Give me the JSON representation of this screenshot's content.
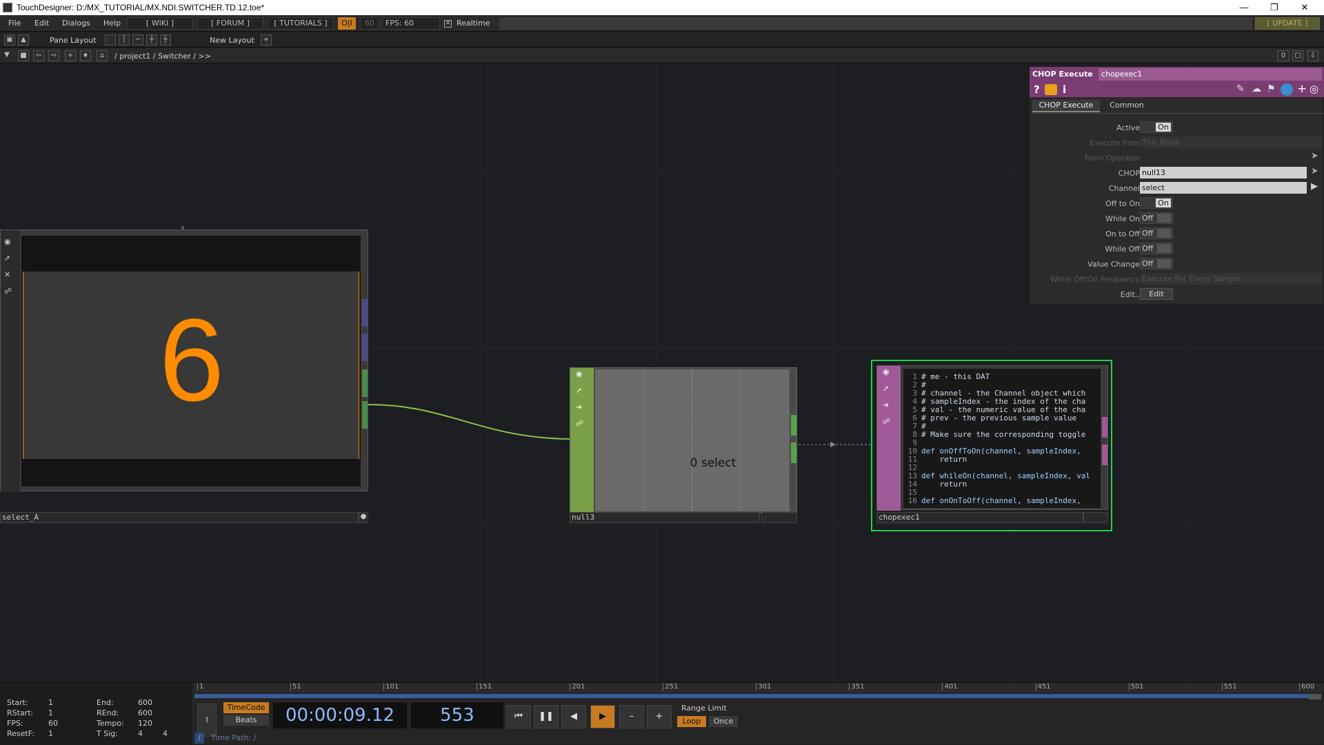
{
  "window": {
    "title": "TouchDesigner: D:/MX_TUTORIAL/MX.NDI.SWITCHER.TD.12.toe*"
  },
  "menu": {
    "items": [
      "File",
      "Edit",
      "Dialogs",
      "Help"
    ],
    "wiki": "[ WIKI ]",
    "forum": "[ FORUM ]",
    "tutorials": "[ TUTORIALS ]",
    "oi": "O|I",
    "fps_cap": "60",
    "fps": "FPS: 60",
    "realtime": "Realtime",
    "update": "[ UPDATE ]"
  },
  "layout": {
    "pane_layout": "Pane Layout",
    "new_layout": "New Layout"
  },
  "path": {
    "crumbs": "/ project1 / Switcher / >>",
    "right_num": "0"
  },
  "nodes": {
    "select_a": {
      "name": "select_A",
      "value": "6",
      "accent": "#ff8c00"
    },
    "null3": {
      "name": "null3",
      "channel_value": "0",
      "channel_name": "select"
    },
    "chopexec": {
      "name": "chopexec1",
      "lines": [
        {
          "n": "1",
          "t": "# me - this DAT"
        },
        {
          "n": "2",
          "t": "#"
        },
        {
          "n": "3",
          "t": "# channel - the Channel object which"
        },
        {
          "n": "4",
          "t": "# sampleIndex - the index of the cha"
        },
        {
          "n": "5",
          "t": "# val - the numeric value of the cha"
        },
        {
          "n": "6",
          "t": "# prev - the previous sample value"
        },
        {
          "n": "7",
          "t": "#"
        },
        {
          "n": "8",
          "t": "# Make sure the corresponding toggle"
        },
        {
          "n": "9",
          "t": ""
        },
        {
          "n": "10",
          "t": "def onOffToOn(channel, sampleIndex,"
        },
        {
          "n": "11",
          "t": "    return"
        },
        {
          "n": "12",
          "t": ""
        },
        {
          "n": "13",
          "t": "def whileOn(channel, sampleIndex, val"
        },
        {
          "n": "14",
          "t": "    return"
        },
        {
          "n": "15",
          "t": ""
        },
        {
          "n": "16",
          "t": "def onOnToOff(channel, sampleIndex,"
        }
      ]
    }
  },
  "params": {
    "type": "CHOP Execute",
    "name": "chopexec1",
    "tabs": [
      "CHOP Execute",
      "Common"
    ],
    "active": {
      "label": "Active",
      "value": "On"
    },
    "execute_from": {
      "label": "Execute from",
      "value": "This Node"
    },
    "from_operator": {
      "label": "From Operator"
    },
    "chop": {
      "label": "CHOP",
      "value": "null13"
    },
    "channel": {
      "label": "Channel",
      "value": "select"
    },
    "off_to_on": {
      "label": "Off to On",
      "value": "On"
    },
    "while_on": {
      "label": "While On",
      "value": "Off"
    },
    "on_to_off": {
      "label": "On to Off",
      "value": "Off"
    },
    "while_off": {
      "label": "While Off",
      "value": "Off"
    },
    "value_change": {
      "label": "Value Change",
      "value": "Off"
    },
    "frequency": {
      "label": "While Off/On Frequency",
      "value": "Execute For Every Sample"
    },
    "edit": {
      "label": "Edit..",
      "button": "Edit"
    }
  },
  "timeline": {
    "ticks": [
      "1",
      "51",
      "101",
      "151",
      "201",
      "251",
      "301",
      "351",
      "401",
      "451",
      "501",
      "551",
      "600"
    ],
    "start": {
      "label": "Start:",
      "value": "1"
    },
    "rstart": {
      "label": "RStart:",
      "value": "1"
    },
    "fps": {
      "label": "FPS:",
      "value": "60"
    },
    "resetf": {
      "label": "ResetF:",
      "value": "1"
    },
    "end": {
      "label": "End:",
      "value": "600"
    },
    "rend": {
      "label": "REnd:",
      "value": "600"
    },
    "tempo": {
      "label": "Tempo:",
      "value": "120"
    },
    "tsig": {
      "label": "T Sig:",
      "value": "4",
      "value2": "4"
    },
    "timecode": "TimeCode",
    "beats": "Beats",
    "time": "00:00:09.12",
    "frame": "553",
    "range_limit": "Range Limit",
    "loop": "Loop",
    "once": "Once",
    "time_path": "Time Path: /",
    "slash": "/",
    "i_btn": "I"
  }
}
